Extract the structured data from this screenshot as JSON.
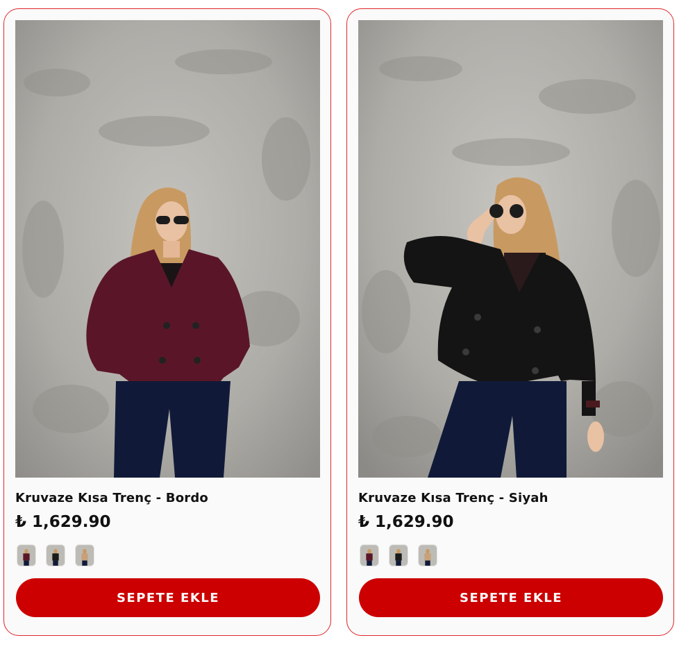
{
  "products": [
    {
      "title": "Kruvaze Kısa Trenç - Bordo",
      "price": "₺ 1,629.90",
      "cart_label": "SEPETE EKLE",
      "coat_color": "#5a1628",
      "swatches": [
        "#5a1628",
        "#1a1a1a",
        "#c8a17a"
      ]
    },
    {
      "title": "Kruvaze Kısa Trenç - Siyah",
      "price": "₺ 1,629.90",
      "cart_label": "SEPETE EKLE",
      "coat_color": "#141414",
      "swatches": [
        "#5a1628",
        "#1a1a1a",
        "#c8a17a"
      ]
    }
  ],
  "colors": {
    "accent": "#cc0000",
    "card_border": "#e0262a"
  }
}
